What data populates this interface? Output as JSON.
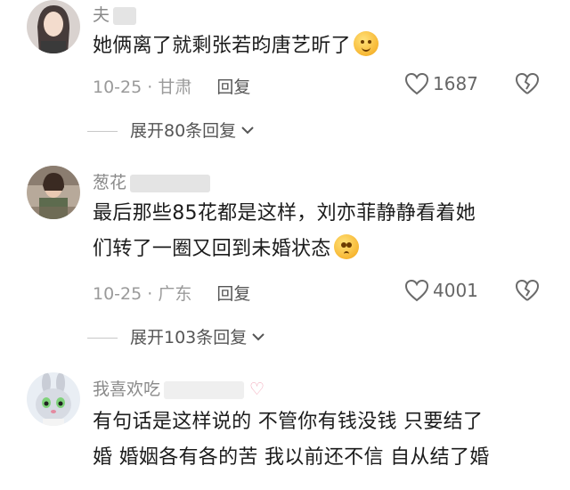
{
  "comments": [
    {
      "username": "夫",
      "text_lines": [
        "她俩离了就剩张若昀唐艺昕了"
      ],
      "emoji": "smirk-emoji",
      "date": "10-25",
      "location": "甘肃",
      "reply_label": "回复",
      "likes": "1687",
      "expand_label": "展开80条回复"
    },
    {
      "username": "葱花",
      "text_lines": [
        "最后那些85花都是这样，刘亦菲静静看着她",
        "们转了一圈又回到未婚状态"
      ],
      "emoji": "pleading-emoji",
      "date": "10-25",
      "location": "广东",
      "reply_label": "回复",
      "likes": "4001",
      "expand_label": "展开103条回复"
    },
    {
      "username": "我喜欢吃",
      "text_lines": [
        "有句话是这样说的 不管你有钱没钱 只要结了",
        "婚 婚姻各有各的苦 我以前还不信 自从结了婚"
      ]
    }
  ],
  "colors": {
    "like_icon": "#6a6a6a",
    "meta_text": "#9a9a9a",
    "username": "#8a8a8a"
  }
}
